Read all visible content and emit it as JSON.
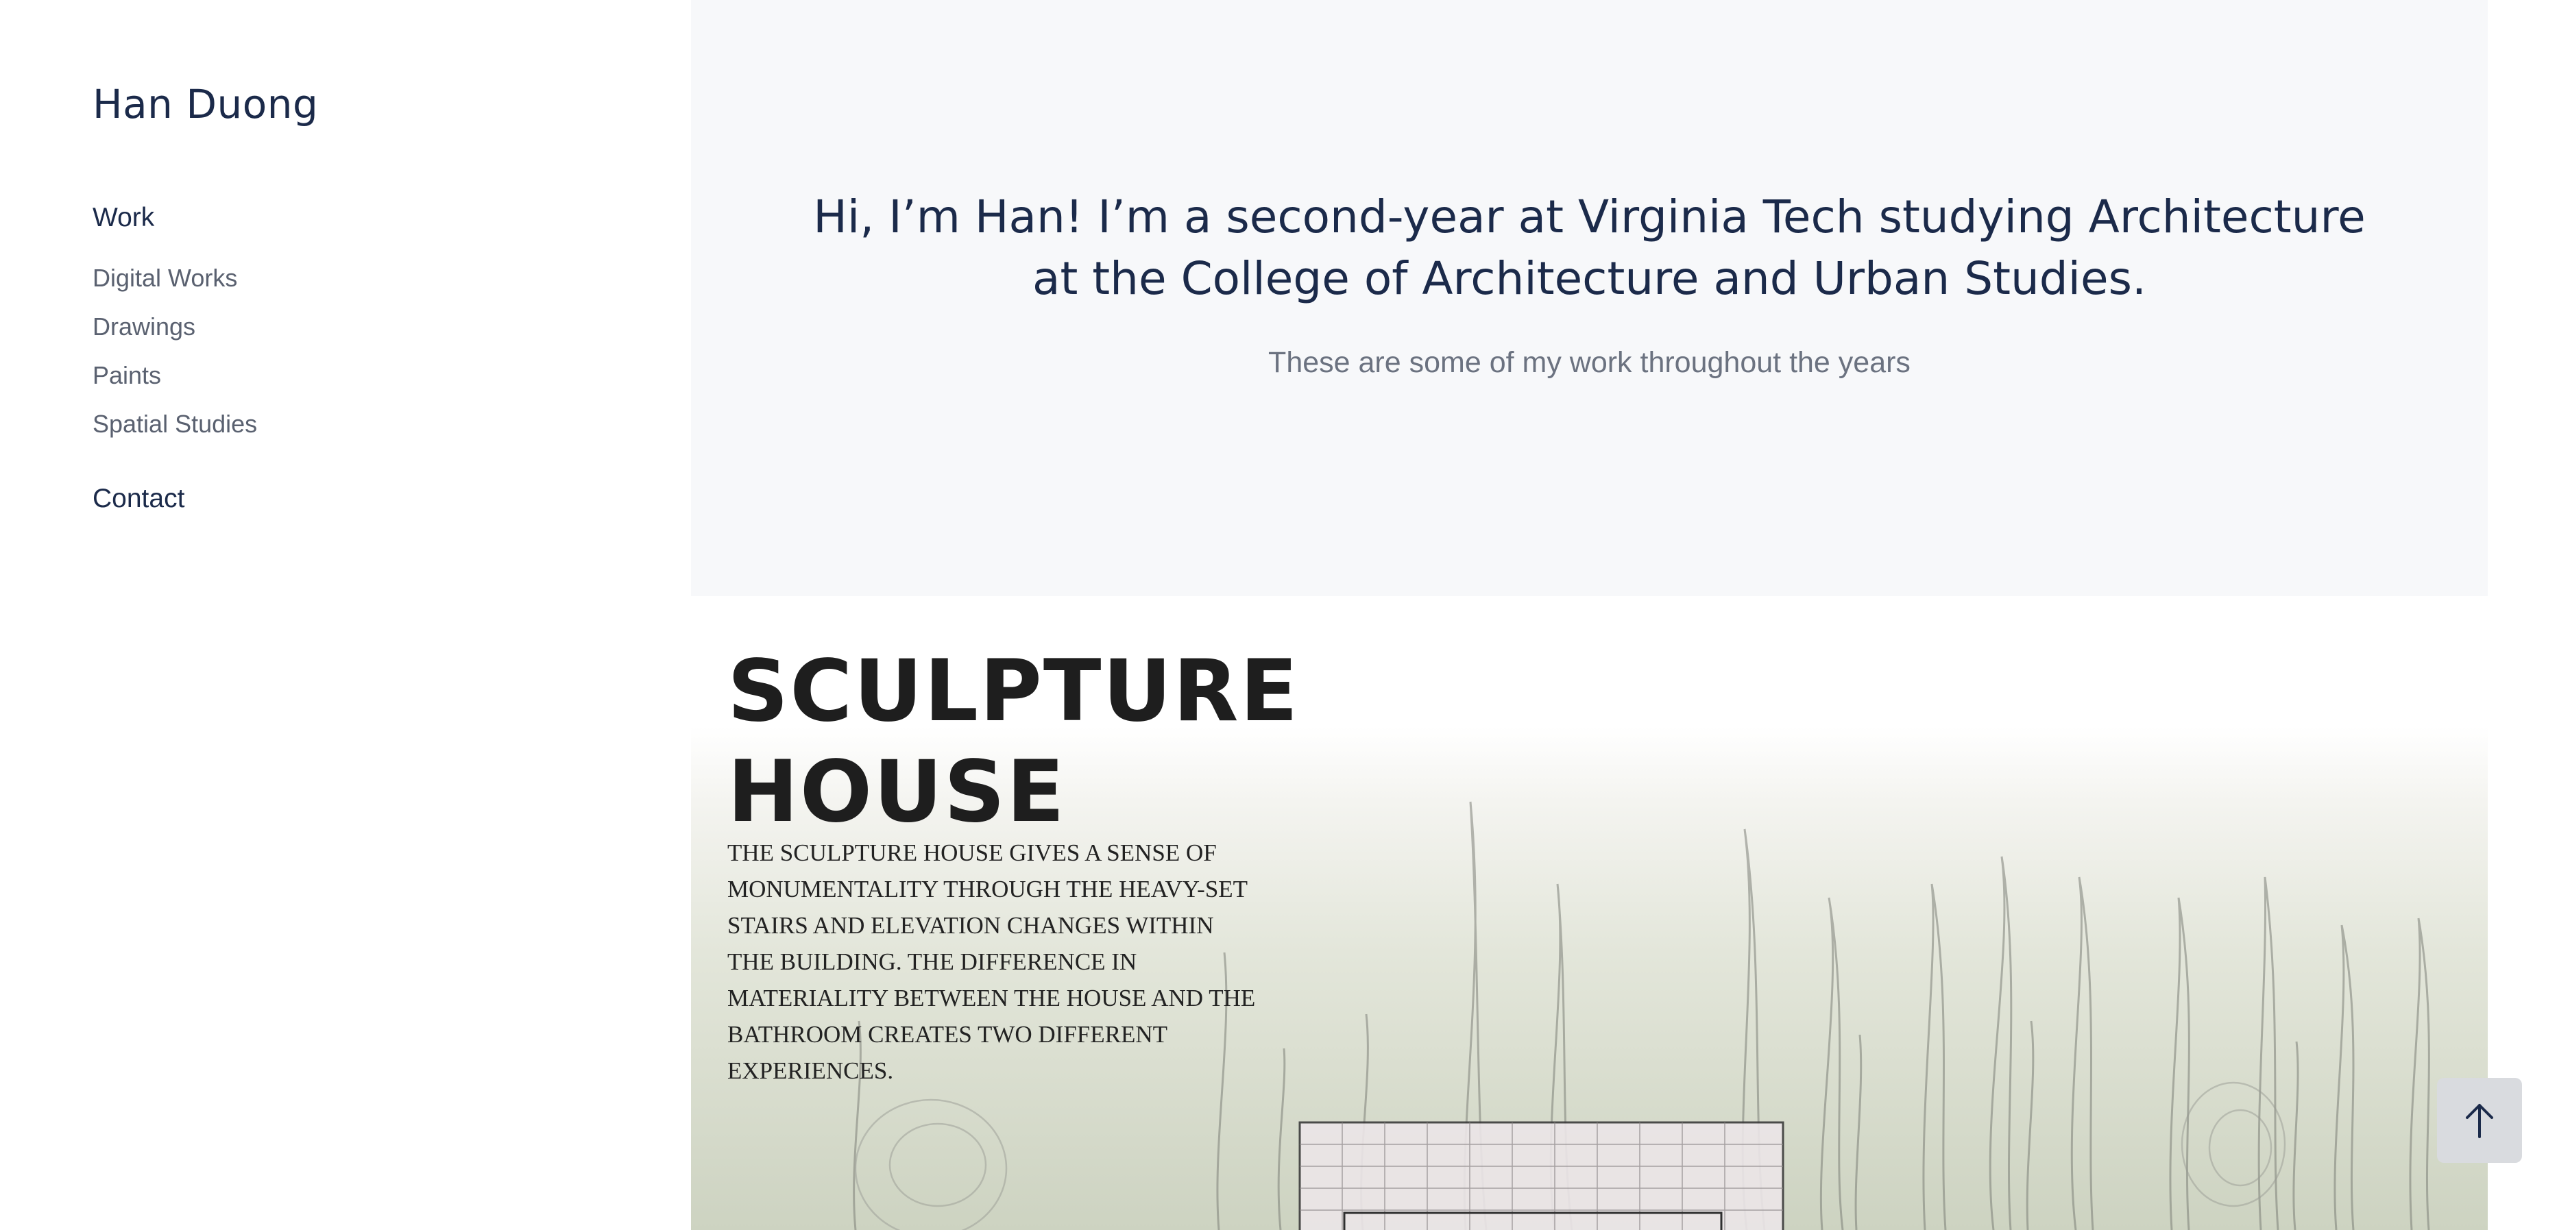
{
  "sidebar": {
    "site_title": "Han Duong",
    "work_heading": "Work",
    "work_links": [
      "Digital Works",
      "Drawings",
      "Paints",
      "Spatial Studies"
    ],
    "contact": "Contact"
  },
  "hero": {
    "headline_line1": "Hi, I’m Han! I’m a second-year at Virginia Tech studying Architecture",
    "headline_line2": "at the College of Architecture and Urban Studies.",
    "subtitle": "These are some of my work throughout the years"
  },
  "project": {
    "title_line1": "SCULPTURE",
    "title_line2": "HOUSE",
    "description": "The sculpture house gives a sense of monumentality through the heavy-set stairs and elevation changes within the building. The difference in materiality between the house and the bathroom creates two different experiences."
  },
  "scroll_top": {
    "icon": "arrow-up-icon"
  },
  "colors": {
    "navy": "#1b2a4a",
    "hero_bg": "#f7f8fa",
    "title_dark": "#1e1e1e",
    "button_bg": "#d9dbdf"
  }
}
